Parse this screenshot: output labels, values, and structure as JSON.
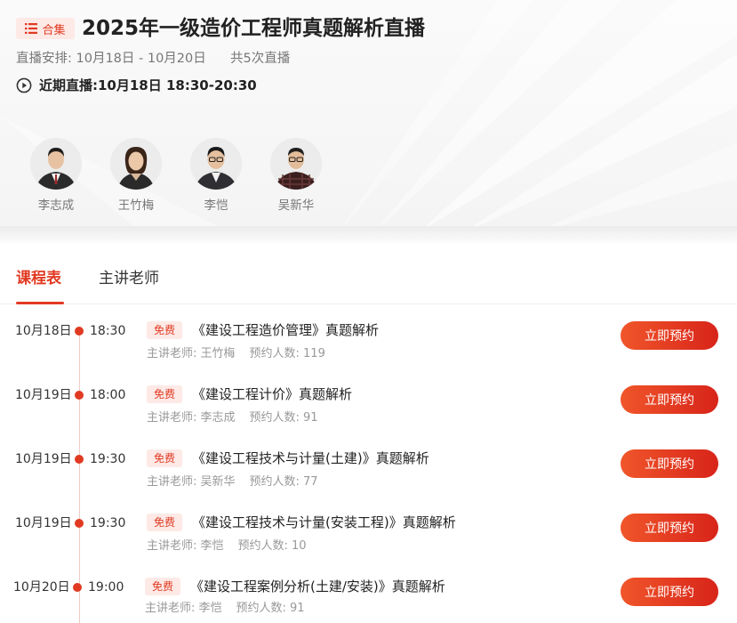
{
  "header": {
    "badge_label": "合集",
    "title": "2025年一级造价工程师真题解析直播",
    "schedule_label": "直播安排:",
    "schedule_range": "10月18日 - 10月20日",
    "session_count": "共5次直播",
    "next_live_label": "近期直播:",
    "next_live_time": "10月18日 18:30-20:30"
  },
  "teachers": [
    {
      "name": "李志成"
    },
    {
      "name": "王竹梅"
    },
    {
      "name": "李恺"
    },
    {
      "name": "吴新华"
    }
  ],
  "tabs": [
    {
      "label": "课程表",
      "active": true
    },
    {
      "label": "主讲老师",
      "active": false
    }
  ],
  "lessons": [
    {
      "date": "10月18日",
      "time": "18:30",
      "badge": "免费",
      "title": "《建设工程造价管理》真题解析",
      "teacher_label": "主讲老师: 王竹梅",
      "reserve_label": "预约人数: 119",
      "button": "立即预约"
    },
    {
      "date": "10月19日",
      "time": "18:00",
      "badge": "免费",
      "title": "《建设工程计价》真题解析",
      "teacher_label": "主讲老师: 李志成",
      "reserve_label": "预约人数: 91",
      "button": "立即预约"
    },
    {
      "date": "10月19日",
      "time": "19:30",
      "badge": "免费",
      "title": "《建设工程技术与计量(土建)》真题解析",
      "teacher_label": "主讲老师: 吴新华",
      "reserve_label": "预约人数: 77",
      "button": "立即预约"
    },
    {
      "date": "10月19日",
      "time": "19:30",
      "badge": "免费",
      "title": "《建设工程技术与计量(安装工程)》真题解析",
      "teacher_label": "主讲老师: 李恺",
      "reserve_label": "预约人数: 10",
      "button": "立即预约"
    },
    {
      "date": "10月20日",
      "time": "19:00",
      "badge": "免费",
      "title": "《建设工程案例分析(土建/安装)》真题解析",
      "teacher_label": "主讲老师: 李恺",
      "reserve_label": "预约人数: 91",
      "button": "立即预约"
    }
  ],
  "colors": {
    "accent": "#e13a22",
    "badge_bg": "#fde9e6",
    "button_start": "#f0562a",
    "button_end": "#d8241a"
  },
  "icons": {
    "collection": "list-icon",
    "next_live": "play-circle-icon"
  }
}
